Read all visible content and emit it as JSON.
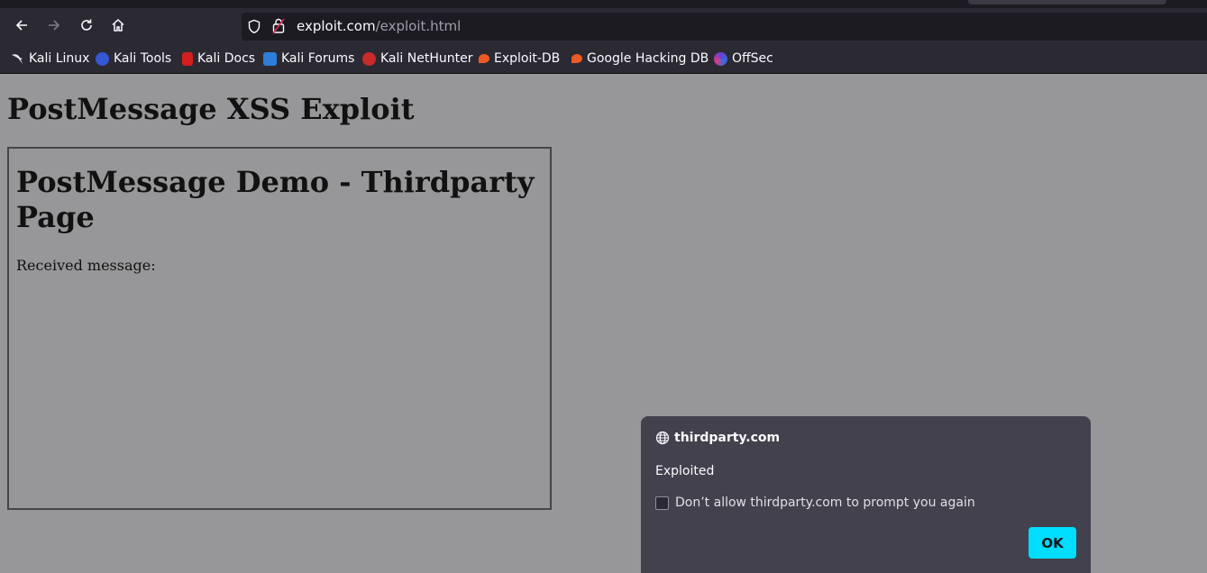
{
  "browser": {
    "url_host": "exploit.com",
    "url_path": "/exploit.html",
    "bookmarks": [
      {
        "label": "Kali Linux",
        "icon": "kali-dragon-icon"
      },
      {
        "label": "Kali Tools",
        "icon": "kali-tools-icon"
      },
      {
        "label": "Kali Docs",
        "icon": "kali-docs-icon"
      },
      {
        "label": "Kali Forums",
        "icon": "kali-forums-icon"
      },
      {
        "label": "Kali NetHunter",
        "icon": "kali-nethunter-icon"
      },
      {
        "label": "Exploit-DB",
        "icon": "exploit-db-icon"
      },
      {
        "label": "Google Hacking DB",
        "icon": "google-hacking-db-icon"
      },
      {
        "label": "OffSec",
        "icon": "offsec-icon"
      }
    ]
  },
  "page": {
    "title": "PostMessage XSS Exploit",
    "iframe": {
      "heading": "PostMessage Demo - Thirdparty Page",
      "received_label": "Received message:"
    }
  },
  "dialog": {
    "origin": "thirdparty.com",
    "message": "Exploited",
    "checkbox_label": "Don’t allow thirdparty.com to prompt you again",
    "checkbox_checked": false,
    "ok_label": "OK"
  },
  "colors": {
    "page_background": "#979799",
    "toolbar": "#2b2a33",
    "dialog_background": "#42414d",
    "ok_button": "#00ddff"
  }
}
